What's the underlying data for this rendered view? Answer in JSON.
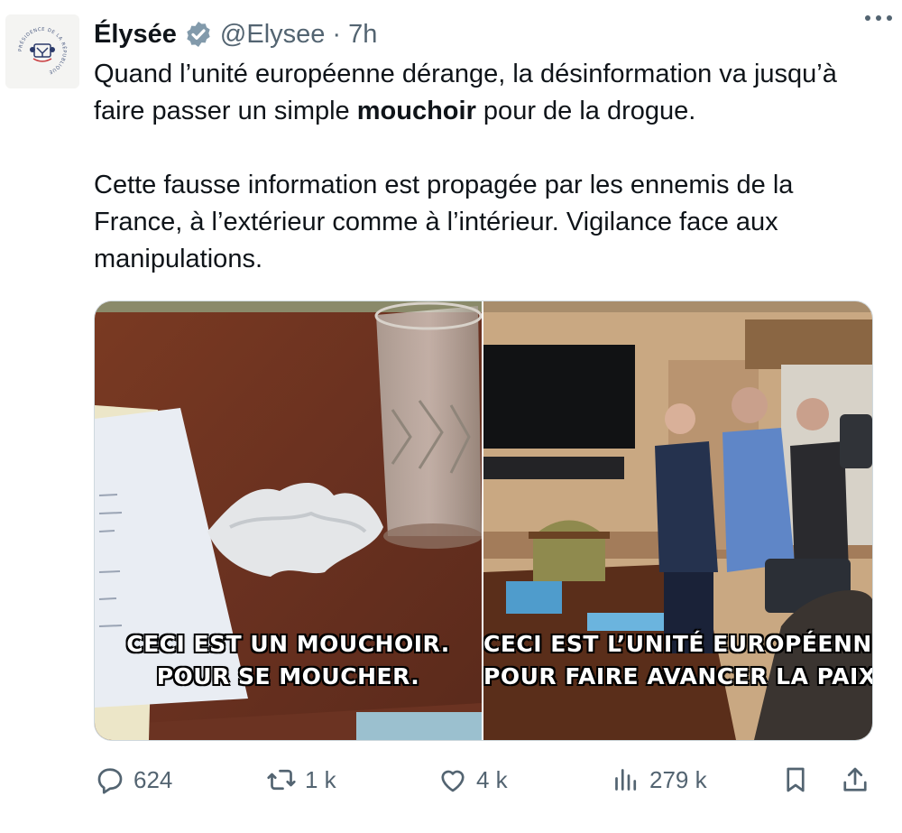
{
  "tweet": {
    "author_name": "Élysée",
    "handle": "@Elysee",
    "separator": "·",
    "time": "7h",
    "paragraph1_before": "Quand l’unité européenne dérange, la désinformation va jusqu’à faire passer un simple ",
    "paragraph1_bold": "mouchoir",
    "paragraph1_after": " pour de la drogue.",
    "paragraph2": "Cette fausse information est propagée par les ennemis de la France, à l’extérieur comme à l’intérieur. Vigilance face aux manipulations."
  },
  "avatar_logo": {
    "arc_text": "PRÉSIDENCE DE LA RÉPUBLIQUE"
  },
  "media": {
    "left_caption_line1": "CECI EST UN MOUCHOIR.",
    "left_caption_line2": "POUR SE MOUCHER.",
    "right_caption_line1": "CECI EST L’UNITÉ EUROPÉENNE.",
    "right_caption_line2": "POUR FAIRE AVANCER LA PAIX."
  },
  "actions": {
    "replies": "624",
    "retweets": "1 k",
    "likes": "4 k",
    "views": "279 k"
  },
  "icons": {
    "verified": "verified-badge-icon",
    "more": "more-options-icon",
    "reply": "reply-icon",
    "retweet": "retweet-icon",
    "like": "heart-icon",
    "views": "views-chart-icon",
    "bookmark": "bookmark-icon",
    "share": "share-icon"
  },
  "colors": {
    "text": "#0f1419",
    "secondary": "#536471",
    "border": "#cfd9de",
    "badge": "#829aab"
  }
}
